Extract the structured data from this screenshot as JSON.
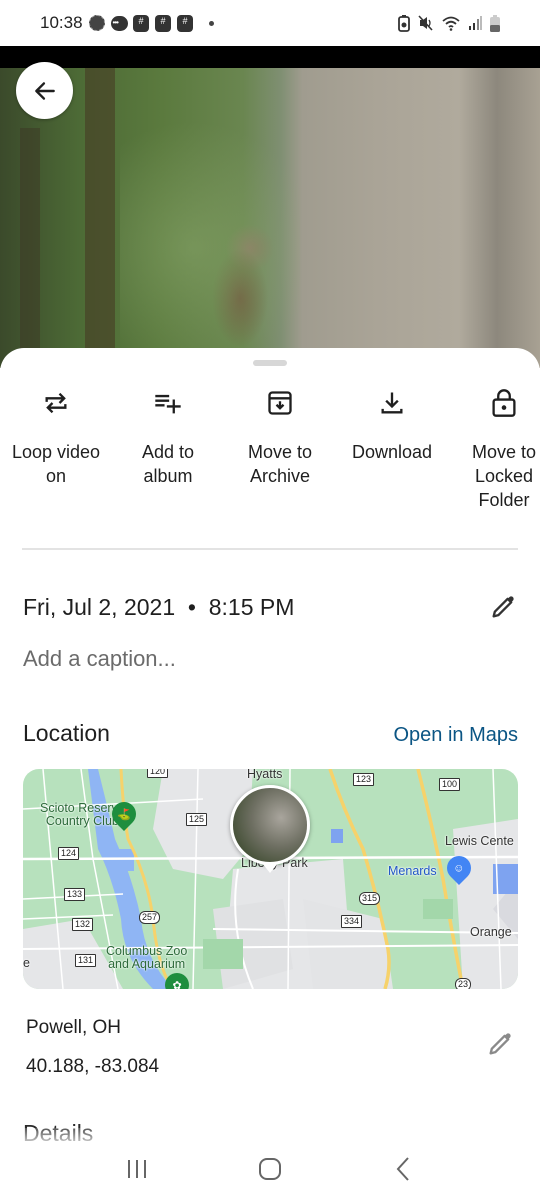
{
  "status_bar": {
    "time": "10:38",
    "left_icons": [
      "signal-app-icon",
      "chat-bubble-icon",
      "groupme-icon",
      "groupme-icon",
      "groupme-icon",
      "more-notifications-dot"
    ],
    "right_icons": [
      "battery-saver-icon",
      "mute-icon",
      "wifi-icon",
      "cell-signal-icon",
      "battery-icon"
    ]
  },
  "photo": {
    "description": "Owl perched in a tree beside a pale tree trunk",
    "back_icon": "arrow-left-icon"
  },
  "actions": [
    {
      "label": "Loop video\non",
      "icon": "repeat-icon"
    },
    {
      "label": "Add to\nalbum",
      "icon": "playlist-add-icon"
    },
    {
      "label": "Move to\nArchive",
      "icon": "archive-icon"
    },
    {
      "label": "Download",
      "icon": "download-icon"
    },
    {
      "label": "Move to\nLocked\nFolder",
      "icon": "lock-icon"
    }
  ],
  "info": {
    "datetime": "Fri, Jul 2, 2021  •  8:15 PM",
    "caption_placeholder": "Add a caption..."
  },
  "location": {
    "title": "Location",
    "open_maps_label": "Open in Maps",
    "accent_color": "#0b5584",
    "place_name": "Powell, OH",
    "coordinates": "40.188, -83.084",
    "map": {
      "labels": {
        "hyatts": "Hyatts",
        "scioto": "Scioto Reserve\nCountry Club",
        "liberty_park": "Liberty Park",
        "lewis_center": "Lewis Cente",
        "menards": "Menards",
        "orange": "Orange",
        "columbus_zoo": "Columbus Zoo\nand Aquarium",
        "edge_e": "e"
      },
      "shields": {
        "r120": "120",
        "r123": "123",
        "r100": "100",
        "r125": "125",
        "r124": "124",
        "r133": "133",
        "r132": "132",
        "r131": "131",
        "r257": "257",
        "r315": "315",
        "r334": "334",
        "r23": "23"
      }
    }
  },
  "details": {
    "title": "Details"
  },
  "nav_bar": {
    "buttons": [
      "recent-apps",
      "home",
      "back"
    ]
  }
}
